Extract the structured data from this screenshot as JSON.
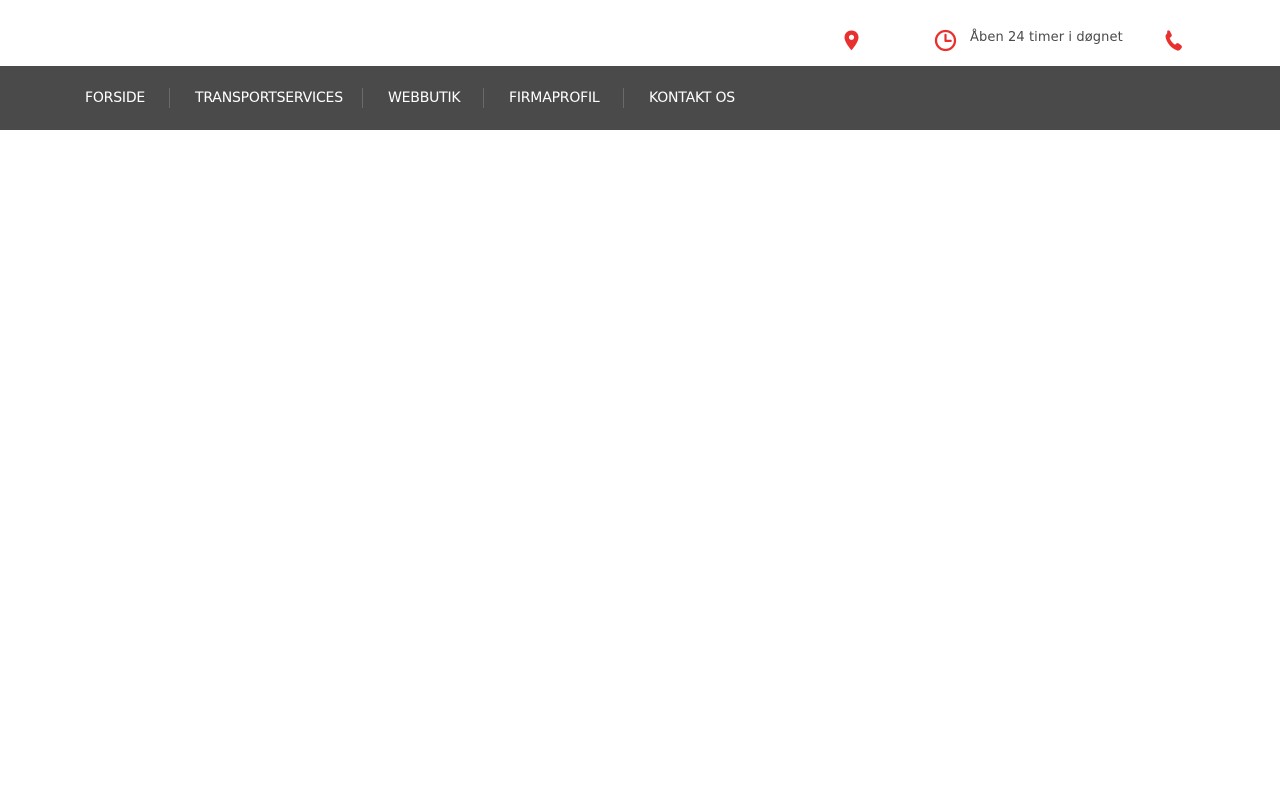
{
  "topbar": {
    "hours_text": "Åben 24 timer i døgnet",
    "icons": {
      "location": "location-pin-icon",
      "clock": "clock-icon",
      "phone": "phone-icon"
    },
    "accent_color": "#e8302f"
  },
  "nav": {
    "background_color": "#4a4a4a",
    "items": [
      {
        "label": "FORSIDE"
      },
      {
        "label": "TRANSPORTSERVICES"
      },
      {
        "label": "WEBBUTIK"
      },
      {
        "label": "FIRMAPROFIL"
      },
      {
        "label": "KONTAKT OS"
      }
    ]
  }
}
